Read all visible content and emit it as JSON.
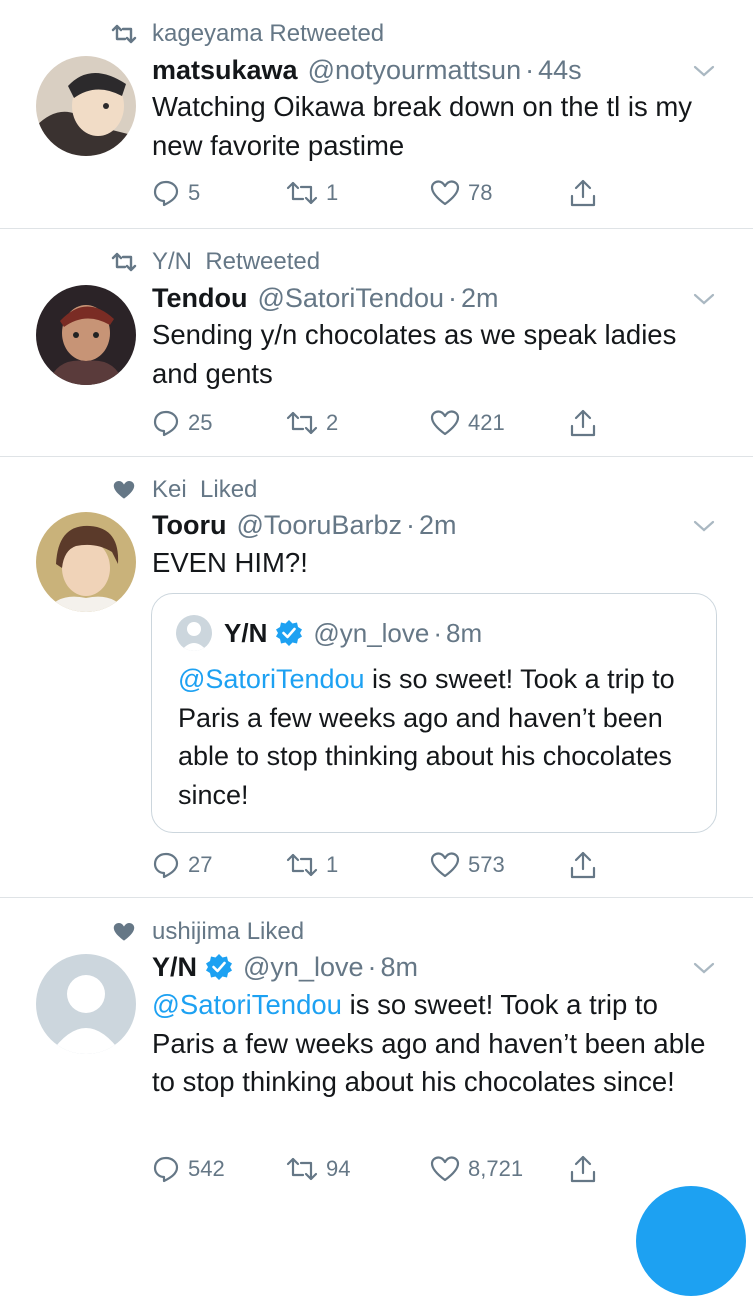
{
  "colors": {
    "accent": "#1da1f2",
    "muted": "#657786",
    "divider": "#dfe3e6"
  },
  "tweets": [
    {
      "context_icon": "retweet-icon",
      "context": "kageyama Retweeted",
      "name": "matsukawa",
      "handle": "@notyourmattsun",
      "dot": "·",
      "time": "44s",
      "text": "Watching Oikawa break down on the tl is my new favorite pastime",
      "replies": "5",
      "retweets": "1",
      "likes": "78"
    },
    {
      "context_icon": "retweet-icon",
      "context": "Y/N  Retweeted",
      "name": "Tendou",
      "handle": "@SatoriTendou",
      "dot": "·",
      "time": "2m",
      "text": "Sending y/n chocolates as we speak ladies and gents",
      "replies": "25",
      "retweets": "2",
      "likes": "421"
    },
    {
      "context_icon": "heart-filled-icon",
      "context": "Kei  Liked",
      "name": "Tooru",
      "handle": "@TooruBarbz",
      "dot": "·",
      "time": "2m",
      "text": "EVEN HIM?!",
      "quote": {
        "name": "Y/N",
        "handle": "@yn_love",
        "dot": "·",
        "time": "8m",
        "mention": "@SatoriTendou",
        "text": " is so sweet! Took a trip to Paris a few weeks ago and haven’t been able to stop thinking about his chocolates since!"
      },
      "replies": "27",
      "retweets": "1",
      "likes": "573"
    },
    {
      "context_icon": "heart-filled-icon",
      "context": "ushijima Liked",
      "name": "Y/N",
      "handle": "@yn_love",
      "dot": "·",
      "time": "8m",
      "mention": "@SatoriTendou",
      "text": " is so sweet! Took a trip to Paris a few weeks ago and haven’t been able to stop thinking about his chocolates since!",
      "replies": "542",
      "retweets": "94",
      "likes": "8,721"
    }
  ]
}
